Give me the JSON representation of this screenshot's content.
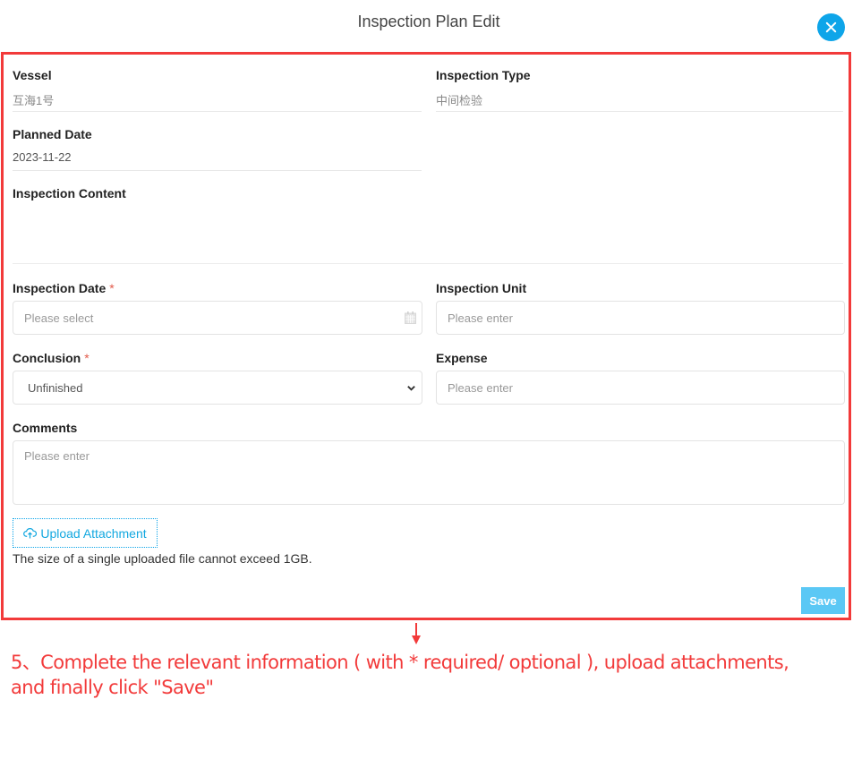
{
  "dialog": {
    "title": "Inspection Plan Edit",
    "close_icon": "close-icon"
  },
  "form": {
    "vessel": {
      "label": "Vessel",
      "value": "互海1号"
    },
    "inspection_type": {
      "label": "Inspection Type",
      "value": "中间检验"
    },
    "planned_date": {
      "label": "Planned Date",
      "value": "2023-11-22"
    },
    "inspection_content": {
      "label": "Inspection Content",
      "value": ""
    },
    "inspection_date": {
      "label": "Inspection Date",
      "required_mark": "*",
      "placeholder": "Please select",
      "icon": "calendar-icon"
    },
    "inspection_unit": {
      "label": "Inspection Unit",
      "placeholder": "Please enter"
    },
    "conclusion": {
      "label": "Conclusion",
      "required_mark": "*",
      "selected": "Unfinished",
      "icon": "chevron-down-icon"
    },
    "expense": {
      "label": "Expense",
      "placeholder": "Please enter"
    },
    "comments": {
      "label": "Comments",
      "placeholder": "Please enter"
    }
  },
  "upload": {
    "button_label": "Upload Attachment",
    "icon": "cloud-upload-icon",
    "note": "The size of a single uploaded file cannot exceed 1GB."
  },
  "actions": {
    "save_label": "Save"
  },
  "annotation": {
    "instruction": "5、Complete the relevant information ( with * required/ optional ), upload attachments, and finally click \"Save\"",
    "highlight_color": "#f23a3a",
    "arrow_icon": "arrow-down-icon"
  },
  "colors": {
    "accent": "#0ea5e9",
    "save_button": "#5bc8f5",
    "required_mark": "#e25a4a",
    "annotation": "#f23a3a"
  }
}
